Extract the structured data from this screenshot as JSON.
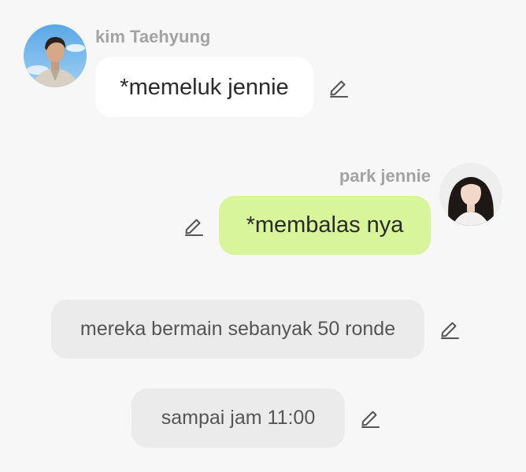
{
  "messages": [
    {
      "type": "received",
      "sender": "kim Taehyung",
      "text": "*memeluk jennie",
      "avatar_icon": "avatar-icon",
      "edit_icon": "pencil-icon"
    },
    {
      "type": "sent",
      "sender": "park jennie",
      "text": "*membalas nya",
      "avatar_icon": "avatar-icon",
      "edit_icon": "pencil-icon"
    },
    {
      "type": "narration",
      "text": "mereka bermain sebanyak 50 ronde",
      "edit_icon": "pencil-icon"
    },
    {
      "type": "narration",
      "text": "sampai jam 11:00",
      "edit_icon": "pencil-icon"
    }
  ],
  "colors": {
    "background": "#f7f7f7",
    "received_bubble": "#ffffff",
    "sent_bubble": "#d8f59c",
    "narration_bubble": "#ebebeb",
    "sender_name": "#a3a3a3"
  }
}
